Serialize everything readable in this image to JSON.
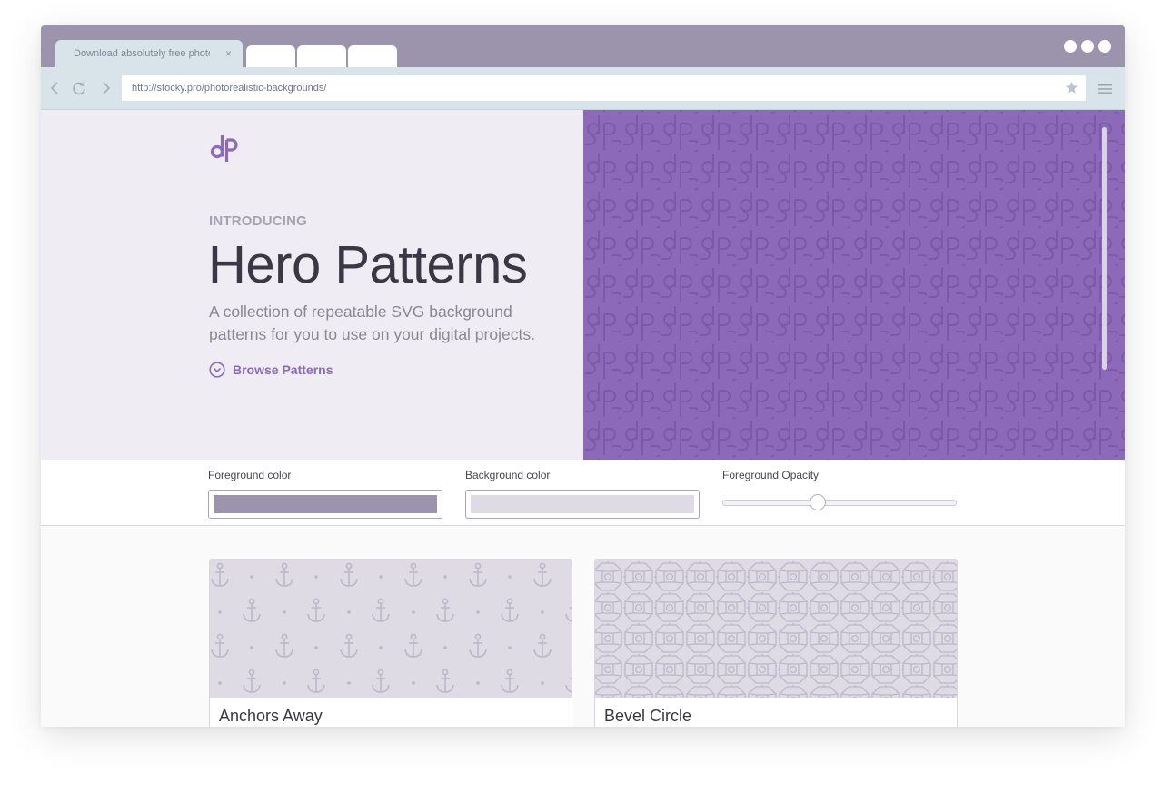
{
  "browser": {
    "tab_title": "Download absolutely free photo.",
    "tab_close": "×",
    "url": "http://stocky.pro/photorealistic-backgrounds/"
  },
  "hero": {
    "eyebrow": "INTRODUCING",
    "title": "Hero Patterns",
    "description": "A collection of repeatable SVG background patterns for you to use on your digital projects.",
    "browse_label": "Browse Patterns"
  },
  "controls": {
    "foreground_label": "Foreground color",
    "background_label": "Background color",
    "opacity_label": "Foreground Opacity",
    "foreground_color": "#9c93ac",
    "background_color": "#dedbe5",
    "opacity_value": 0.4
  },
  "patterns": [
    {
      "name": "Anchors Away",
      "icon": "anchor-pattern"
    },
    {
      "name": "Bevel Circle",
      "icon": "bevel-circle-pattern"
    }
  ],
  "colors": {
    "accent": "#8d6ab9",
    "titlebar": "#9c93ac",
    "toolbar": "#d9e3ea"
  }
}
